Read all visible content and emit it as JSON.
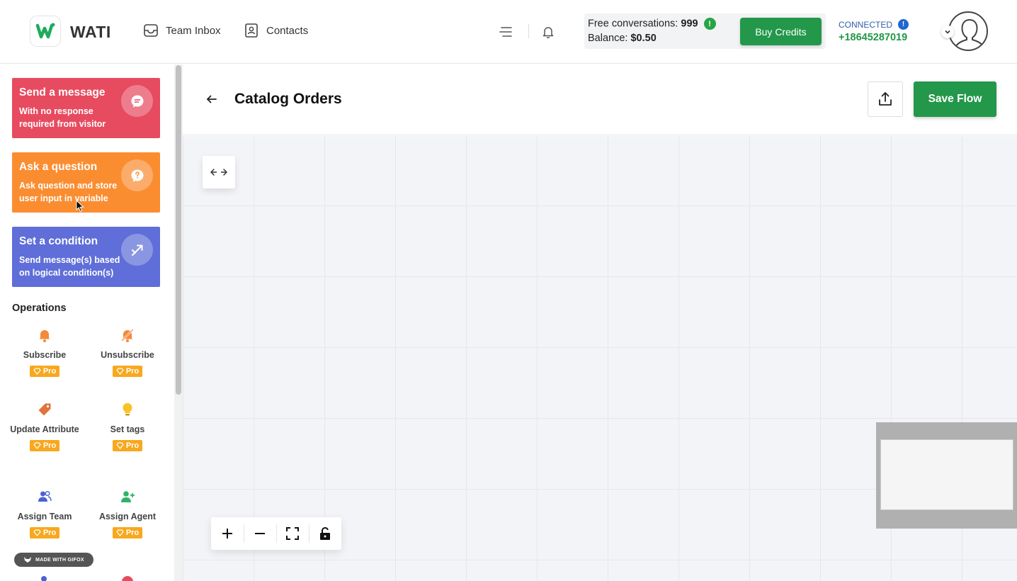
{
  "app": {
    "name": "WATI"
  },
  "nav": {
    "team_inbox": "Team Inbox",
    "contacts": "Contacts"
  },
  "credits": {
    "free_label": "Free conversations:",
    "free_value": "999",
    "balance_label": "Balance:",
    "balance_value": "$0.50",
    "buy_label": "Buy Credits"
  },
  "connection": {
    "status": "CONNECTED",
    "phone": "+18645287019"
  },
  "sidebar": {
    "cards": [
      {
        "title": "Send a message",
        "subtitle": "With no response required from visitor",
        "color": "#e74b60"
      },
      {
        "title": "Ask a question",
        "subtitle": "Ask question and store user input in variable",
        "color": "#fb8d31"
      },
      {
        "title": "Set a condition",
        "subtitle": "Send message(s) based on logical condition(s)",
        "color": "#5f6ed8"
      }
    ],
    "operations_heading": "Operations",
    "operations": [
      {
        "label": "Subscribe",
        "icon": "bell-icon",
        "badge": "Pro"
      },
      {
        "label": "Unsubscribe",
        "icon": "bell-off-icon",
        "badge": "Pro"
      },
      {
        "label": "Update Attribute",
        "icon": "tag-icon",
        "badge": "Pro"
      },
      {
        "label": "Set tags",
        "icon": "lightbulb-icon",
        "badge": "Pro"
      },
      {
        "label": "Assign Team",
        "icon": "team-icon",
        "badge": "Pro"
      },
      {
        "label": "Assign Agent",
        "icon": "add-user-icon",
        "badge": "Pro"
      }
    ],
    "watermark": "MADE WITH GIFOX"
  },
  "main": {
    "title": "Catalog Orders",
    "save_label": "Save Flow"
  },
  "colors": {
    "brand_green": "#23974a",
    "canvas_bg": "#f3f4f7"
  }
}
